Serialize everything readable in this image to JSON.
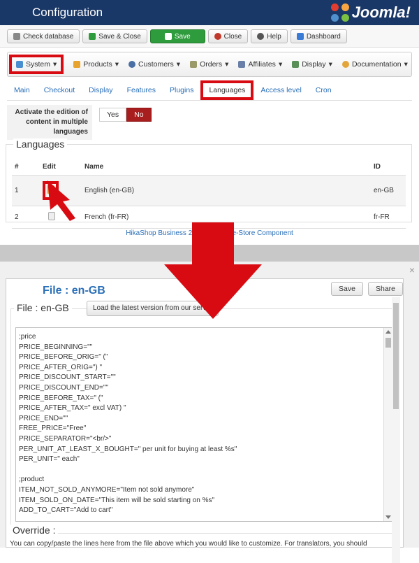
{
  "header": {
    "title": "Configuration",
    "logo_text": "Joomla!"
  },
  "toolbar": {
    "check_database": "Check database",
    "save_close": "Save & Close",
    "save": "Save",
    "close": "Close",
    "help": "Help",
    "dashboard": "Dashboard"
  },
  "menu": {
    "system": "System",
    "products": "Products",
    "customers": "Customers",
    "orders": "Orders",
    "affiliates": "Affiliates",
    "display": "Display",
    "documentation": "Documentation"
  },
  "tabs": [
    "Main",
    "Checkout",
    "Display",
    "Features",
    "Plugins",
    "Languages",
    "Access level",
    "Cron"
  ],
  "option": {
    "label": "Activate the edition of content in multiple languages",
    "yes": "Yes",
    "no": "No"
  },
  "languages": {
    "legend": "Languages",
    "headers": {
      "num": "#",
      "edit": "Edit",
      "name": "Name",
      "id": "ID"
    },
    "rows": [
      {
        "num": "1",
        "name": "English (en-GB)",
        "id": "en-GB"
      },
      {
        "num": "2",
        "name": "French (fr-FR)",
        "id": "fr-FR"
      }
    ]
  },
  "footer": "HikaShop Business 2.6.3, Joomla e-Store Component",
  "file_panel": {
    "title": "File : en-GB",
    "save": "Save",
    "share": "Share",
    "legend": "File : en-GB",
    "load_button": "Load the latest version from our server",
    "lines": [
      ";price",
      "PRICE_BEGINNING=\"\"",
      "PRICE_BEFORE_ORIG=\" (\"",
      "PRICE_AFTER_ORIG=\") \"",
      "PRICE_DISCOUNT_START=\"\"",
      "PRICE_DISCOUNT_END=\"\"",
      "PRICE_BEFORE_TAX=\" (\"",
      "PRICE_AFTER_TAX=\" excl VAT) \"",
      "PRICE_END=\"\"",
      "FREE_PRICE=\"Free\"",
      "PRICE_SEPARATOR=\"<br/>\"",
      "PER_UNIT_AT_LEAST_X_BOUGHT=\" per unit for buying at least %s\"",
      "PER_UNIT=\" each\"",
      "",
      ";product",
      "ITEM_NOT_SOLD_ANYMORE=\"Item not sold anymore\"",
      "ITEM_SOLD_ON_DATE=\"This item will be sold starting on %s\"",
      "ADD_TO_CART=\"Add to cart\""
    ],
    "override_legend": "Override :",
    "override_text": "You can copy/paste the lines here from the file above which you would like to customize. For translators, you should"
  },
  "close_symbol": "×",
  "colors": {
    "header": "#1a3867",
    "highlight": "#d80b12",
    "link": "#2a6fb8",
    "save": "#2e9b3c"
  }
}
